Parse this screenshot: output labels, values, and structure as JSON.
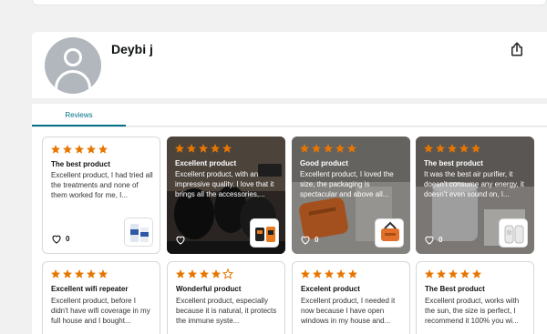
{
  "profile": {
    "name": "Deybi j"
  },
  "tabs": {
    "reviews_label": "Reviews"
  },
  "colors": {
    "star": "#e77600",
    "accent": "#007185"
  },
  "reviews_row1": [
    {
      "rating": 5,
      "title": "The best product",
      "text": "Excellent product, I had tried all the treatments and none of them worked for me, I...",
      "likes": "0",
      "has_photo": false
    },
    {
      "rating": 5,
      "title": "Excellent product",
      "text": "Excellent product, with an impressive quality, I love that it brings all the accessories,...",
      "likes": "",
      "has_photo": true
    },
    {
      "rating": 5,
      "title": "Good product",
      "text": "Excellent product, I loved the size, the packaging is spectacular and above all...",
      "likes": "0",
      "has_photo": true
    },
    {
      "rating": 5,
      "title": "The best product",
      "text": "It was the best air purifier, it doesn't consume any energy, it doesn't even sound on, I...",
      "likes": "0",
      "has_photo": true
    }
  ],
  "reviews_row2": [
    {
      "rating": 5,
      "title": "Excellent wifi repeater",
      "text": "Excellent product, before I didn't have wifi coverage in my full house and I bought..."
    },
    {
      "rating": 4,
      "title": "Wonderful product",
      "text": "Excellent product, especially because it is natural, it protects the immune syste..."
    },
    {
      "rating": 5,
      "title": "Excelent product",
      "text": "Excellent product, I needed it now because I have open windows in my house and..."
    },
    {
      "rating": 5,
      "title": "The Best product",
      "text": "Excellent product, works with the sun, the size is perfect, I recommend it 100% you wi..."
    }
  ]
}
